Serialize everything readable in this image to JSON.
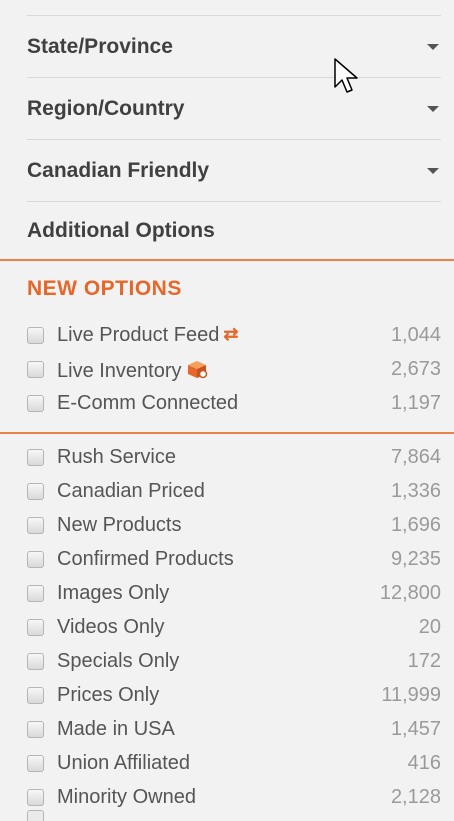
{
  "filters": {
    "state_label": "State/Province",
    "region_label": "Region/Country",
    "canadian_label": "Canadian Friendly",
    "additional_label": "Additional Options"
  },
  "new_options": {
    "title": "NEW OPTIONS",
    "items": [
      {
        "label": "Live Product Feed",
        "count": "1,044",
        "icon": "sync-arrows-icon"
      },
      {
        "label": "Live Inventory",
        "count": "2,673",
        "icon": "inventory-box-icon"
      },
      {
        "label": "E-Comm Connected",
        "count": "1,197"
      }
    ]
  },
  "options": {
    "items": [
      {
        "label": "Rush Service",
        "count": "7,864"
      },
      {
        "label": "Canadian Priced",
        "count": "1,336"
      },
      {
        "label": "New Products",
        "count": "1,696"
      },
      {
        "label": "Confirmed Products",
        "count": "9,235"
      },
      {
        "label": "Images Only",
        "count": "12,800"
      },
      {
        "label": "Videos Only",
        "count": "20"
      },
      {
        "label": "Specials Only",
        "count": "172"
      },
      {
        "label": "Prices Only",
        "count": "11,999"
      },
      {
        "label": "Made in USA",
        "count": "1,457"
      },
      {
        "label": "Union Affiliated",
        "count": "416"
      },
      {
        "label": "Minority Owned",
        "count": "2,128"
      }
    ]
  },
  "colors": {
    "accent": "#e5672a",
    "divider": "#e8804a",
    "background": "#f2f2f2"
  }
}
